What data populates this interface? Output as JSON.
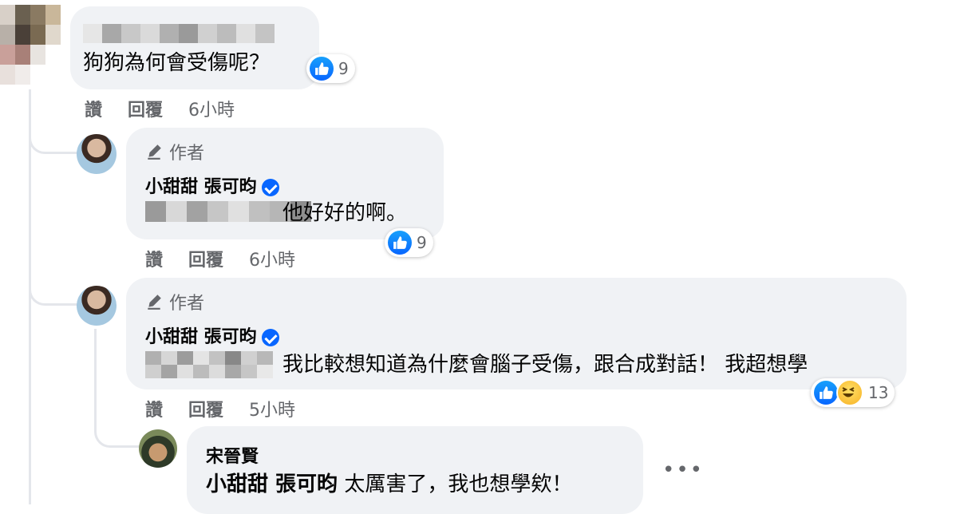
{
  "comments": [
    {
      "text": "狗狗為何會受傷呢？",
      "reaction_count": "9",
      "actions": {
        "like": "讚",
        "reply": "回覆",
        "time": "6小時"
      }
    },
    {
      "author_tag": "作者",
      "name": "小甜甜 張可昀",
      "text": "他好好的啊。",
      "reaction_count": "9",
      "actions": {
        "like": "讚",
        "reply": "回覆",
        "time": "6小時"
      }
    },
    {
      "author_tag": "作者",
      "name": "小甜甜 張可昀",
      "text": "我比較想知道為什麼會腦子受傷，跟合成對話！ 我超想學",
      "reaction_count": "13",
      "actions": {
        "like": "讚",
        "reply": "回覆",
        "time": "5小時"
      }
    },
    {
      "name": "宋晉賢",
      "mention": "小甜甜 張可昀",
      "text": "太厲害了，我也想學欸！",
      "more": "•••"
    }
  ],
  "colors": {
    "bubble": "#f0f2f5",
    "like_blue": "#0866ff",
    "secondary_text": "#65676b",
    "thread_line": "#e4e6eb"
  },
  "icons": [
    "like-icon",
    "haha-icon",
    "verified-badge-icon",
    "pen-icon",
    "more-options-icon"
  ]
}
